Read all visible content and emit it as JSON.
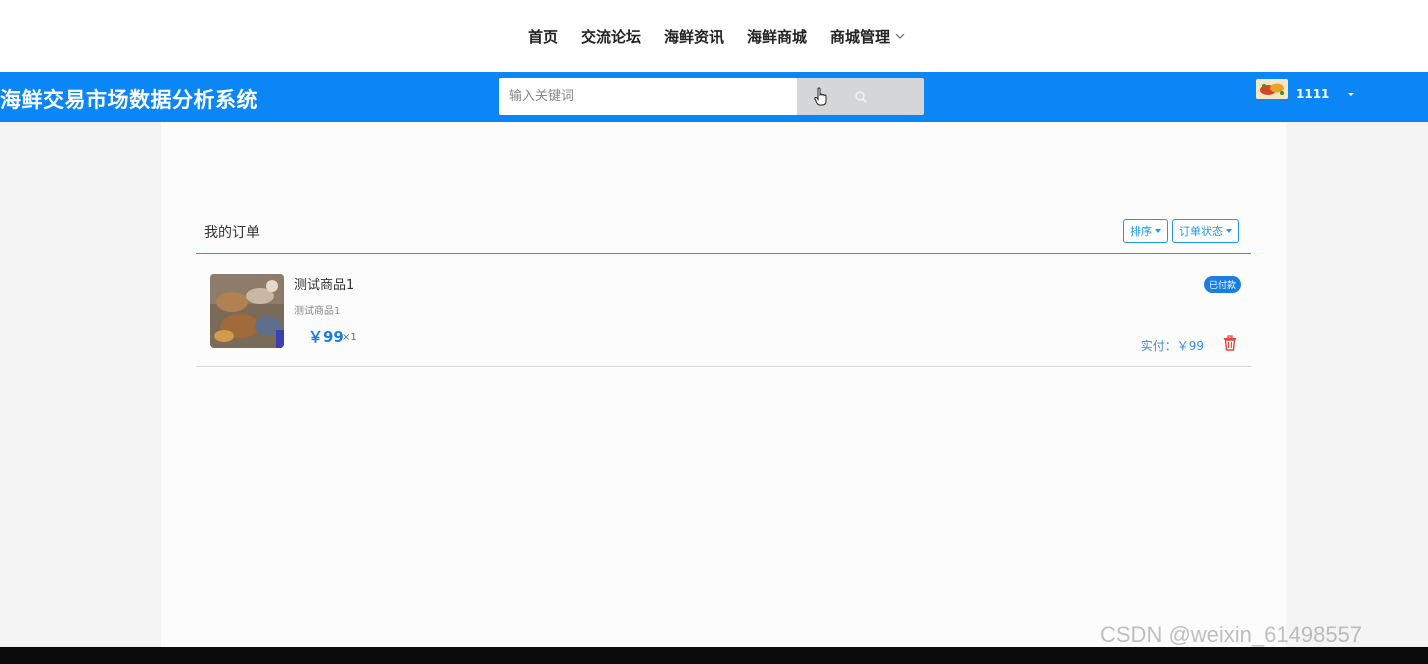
{
  "nav": {
    "items": [
      {
        "label": "首页"
      },
      {
        "label": "交流论坛"
      },
      {
        "label": "海鲜资讯"
      },
      {
        "label": "海鲜商城"
      },
      {
        "label": "商城管理"
      }
    ]
  },
  "header": {
    "title": "海鲜交易市场数据分析系统",
    "search_placeholder": "输入关键词",
    "username": "1111"
  },
  "orders": {
    "title": "我的订单",
    "sort_label": "排序",
    "status_filter_label": "订单状态",
    "items": [
      {
        "name": "测试商品1",
        "subtitle": "测试商品1",
        "price": "￥99",
        "quantity": "×1",
        "status": "已付款",
        "paid_total": "实付：￥99"
      }
    ]
  },
  "watermark": "CSDN @weixin_61498557",
  "colors": {
    "header_blue": "#0a86f7",
    "accent_blue": "#1a7ee0",
    "delete_red": "#e0483c"
  },
  "icons": [
    "chevron-down-icon",
    "search-icon",
    "hand-cursor-icon",
    "caret-down-icon",
    "trash-icon"
  ]
}
